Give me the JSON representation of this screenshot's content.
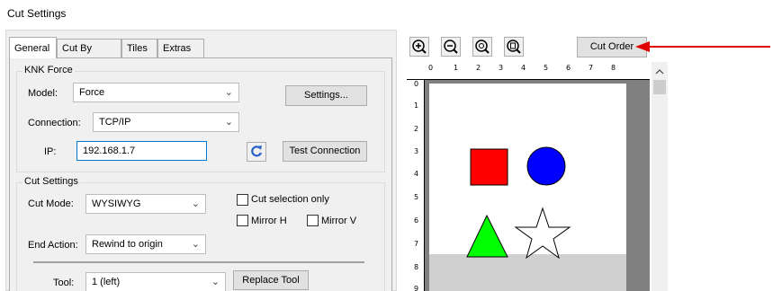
{
  "window": {
    "title": "Cut Settings"
  },
  "tabs": [
    {
      "label": "General",
      "active": true
    },
    {
      "label": "Cut By Color"
    },
    {
      "label": "Tiles"
    },
    {
      "label": "Extras"
    }
  ],
  "knk": {
    "group_label": "KNK Force",
    "model_label": "Model:",
    "model_value": "Force",
    "settings_button": "Settings...",
    "connection_label": "Connection:",
    "connection_value": "TCP/IP",
    "ip_label": "IP:",
    "ip_value": "192.168.1.7",
    "test_connection_button": "Test Connection"
  },
  "cut_settings": {
    "group_label": "Cut Settings",
    "cut_mode_label": "Cut Mode:",
    "cut_mode_value": "WYSIWYG",
    "cut_selection_only": "Cut selection only",
    "mirror_h": "Mirror H",
    "mirror_v": "Mirror V",
    "end_action_label": "End Action:",
    "end_action_value": "Rewind to origin",
    "tool_label": "Tool:",
    "tool_value": "1 (left)",
    "replace_tool_button": "Replace Tool"
  },
  "toolbar": {
    "cut_order_button": "Cut Order",
    "icons": [
      "zoom-in-icon",
      "zoom-out-icon",
      "zoom-fit-icon",
      "zoom-page-icon"
    ]
  },
  "ruler": {
    "top_ticks": [
      "0",
      "1",
      "2",
      "3",
      "4",
      "5",
      "6",
      "7",
      "8"
    ],
    "left_ticks": [
      "0",
      "1",
      "2",
      "3",
      "4",
      "5",
      "6",
      "7",
      "8",
      "9"
    ]
  },
  "colors": {
    "square": "#ff0000",
    "circle": "#0000ff",
    "triangle": "#00ff00",
    "star": "#ffffff",
    "arrow": "#e00000",
    "focus_border": "#0078d7"
  }
}
